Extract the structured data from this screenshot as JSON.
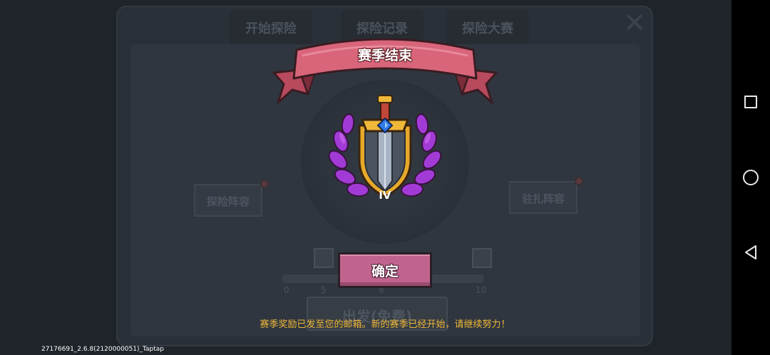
{
  "background": {
    "tabs": [
      "开始探险",
      "探险记录",
      "探险大赛"
    ],
    "left_button": "探险阵容",
    "right_button": "驻扎阵容",
    "progress_ticks": [
      "0",
      "5",
      "8",
      "10"
    ],
    "bottom_button": "出发(免费)"
  },
  "modal": {
    "title": "赛季结束",
    "rank": "IV",
    "confirm_label": "确定",
    "message": "赛季奖励已发至您的邮箱。新的赛季已经开始，请继续努力！"
  },
  "footer": {
    "version": "27176691_2.6.8(2120000051)_Taptap"
  },
  "colors": {
    "ribbon": "#d8657a",
    "button": "#c0648e",
    "message": "#f0b838",
    "laurel": "#a23bd6"
  },
  "icons": {
    "close": "close-icon",
    "badge": "sword-shield-badge-icon",
    "nav_recent": "square-icon",
    "nav_home": "circle-icon",
    "nav_back": "triangle-back-icon"
  }
}
